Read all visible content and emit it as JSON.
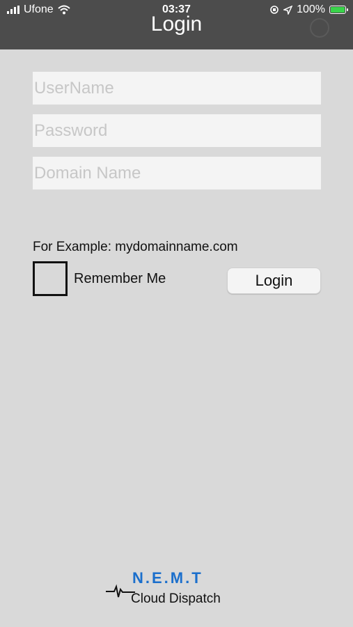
{
  "status": {
    "carrier": "Ufone",
    "time": "03:37",
    "battery": "100%"
  },
  "header": {
    "title": "Login"
  },
  "form": {
    "username_placeholder": "UserName",
    "password_placeholder": "Password",
    "domain_placeholder": "Domain Name",
    "example_text": "For Example: mydomainname.com",
    "remember_label": "Remember Me",
    "login_label": "Login"
  },
  "logo": {
    "line1": "N.E.M.T",
    "line2": "Cloud Dispatch"
  },
  "colors": {
    "header_bg": "#4c4c4c",
    "page_bg": "#d9d9d9",
    "field_bg": "#f4f4f4",
    "brand_blue": "#1b6fcc",
    "battery_green": "#39d34a"
  }
}
